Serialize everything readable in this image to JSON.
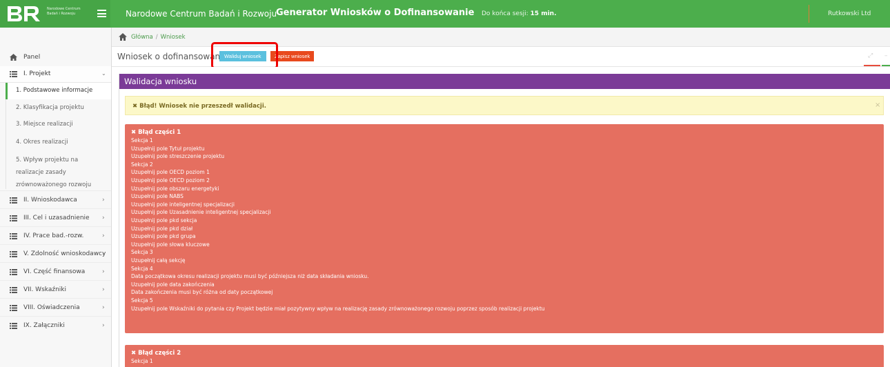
{
  "topbar": {
    "logo_text": "Narodowe Centrum Badań i Rozwoju",
    "org_name": "Narodowe Centrum Badań i Rozwoju",
    "app_title": "Generator Wniosków o Dofinansowanie",
    "session_label": "Do końca sesji:",
    "session_value": "15 min.",
    "user_name": "Rutkowski Ltd"
  },
  "breadcrumb": {
    "home": "Główna",
    "separator": "/",
    "current": "Wniosek"
  },
  "sidebar": {
    "panel": "Panel",
    "section_project": "I. Projekt",
    "sub_items": [
      "1. Podstawowe informacje",
      "2. Klasyfikacja projektu",
      "3. Miejsce realizacji",
      "4. Okres realizacji",
      "5. Wpływ projektu na",
      "realizacje zasady",
      "zrównoważonego rozwoju"
    ],
    "sections": [
      "II. Wnioskodawca",
      "III. Cel i uzasadnienie",
      "IV. Prace bad.-rozw.",
      "V. Zdolność wnioskodawcy",
      "VI. Część finansowa",
      "VII. Wskaźniki",
      "VIII. Oświadczenia",
      "IX. Załączniki"
    ]
  },
  "header": {
    "title": "Wniosek o dofinansowanie",
    "validate_button": "Waliduj wniosek",
    "save_button": "Zapisz wniosek"
  },
  "panel": {
    "title": "Walidacja wniosku",
    "warning": "Błąd! Wniosek nie przeszedł walidacji.",
    "close": "×"
  },
  "errors": [
    {
      "title": "Błąd części 1",
      "lines": [
        "Sekcja 1",
        "Uzupełnij pole Tytuł projektu",
        "Uzupełnij pole streszczenie projektu",
        "Sekcja 2",
        "Uzupełnij pole OECD poziom 1",
        "Uzupełnij pole OECD poziom 2",
        "Uzupełnij pole obszaru energetyki",
        "Uzupełnij pole NABS",
        "Uzupełnij pole inteligentnej specjalizacji",
        "Uzupełnij pole Uzasadnienie inteligentnej specjalizacji",
        "Uzupełnij pole pkd sekcja",
        "Uzupełnij pole pkd dział",
        "Uzupełnij pole pkd grupa",
        "Uzupełnij pole słowa kluczowe",
        "Sekcja 3",
        "Uzupełnij całą sekcję",
        "Sekcja 4",
        "Data początkowa okresu realizacji projektu musi być późniejsza niż data składania wniosku.",
        "Uzupełnij pole data zakończenia",
        "Data zakończenia musi być różna od daty początkowej",
        "Sekcja 5",
        "Uzupełnij pole Wskaźniki do pytania czy Projekt będzie miał pozytywny wpływ na realizację zasady zrównoważonego rozwoju poprzez sposób realizacji projektu"
      ]
    },
    {
      "title": "Błąd części 2",
      "lines": [
        "Sekcja 1"
      ]
    }
  ],
  "colors": {
    "topbar": "#4cae4c",
    "panel_header": "#7b3b97",
    "error_box": "#e56f60",
    "validate_button": "#5bc0de",
    "save_button": "#e8491d",
    "highlight": "#e00000"
  }
}
